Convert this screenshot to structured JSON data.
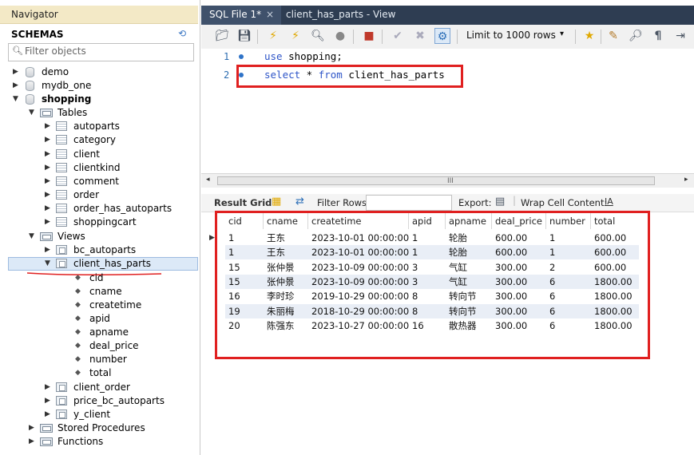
{
  "navigator": {
    "title": "Navigator",
    "schemas_label": "SCHEMAS",
    "filter_placeholder": "Filter objects",
    "schemas": [
      "demo",
      "mydb_one"
    ],
    "active_schema": "shopping",
    "tables_label": "Tables",
    "tables": [
      "autoparts",
      "category",
      "client",
      "clientkind",
      "comment",
      "order",
      "order_has_autoparts",
      "shoppingcart"
    ],
    "views_label": "Views",
    "views_before": [
      "bc_autoparts"
    ],
    "selected_view": "client_has_parts",
    "columns": [
      "cid",
      "cname",
      "createtime",
      "apid",
      "apname",
      "deal_price",
      "number",
      "total"
    ],
    "views_after": [
      "client_order",
      "price_bc_autoparts",
      "y_client"
    ],
    "stored_procedures_label": "Stored Procedures",
    "functions_label": "Functions"
  },
  "tabs": {
    "active": "SQL File 1*",
    "close": "×",
    "other": "client_has_parts - View"
  },
  "toolbar": {
    "limit_label": "Limit to 1000 rows",
    "limit_arrow": "▾"
  },
  "editor": {
    "line_numbers": [
      "1",
      "2"
    ],
    "line1": {
      "kw": "use",
      "rest": " shopping;"
    },
    "line2": {
      "kw1": "select",
      "mid": " * ",
      "kw2": "from",
      "rest": " client_has_parts"
    }
  },
  "scroll": {
    "left": "◂",
    "grip": "III",
    "right": "▸"
  },
  "result_toolbar": {
    "result_grid_label": "Result Grid",
    "filter_rows_label": "Filter Rows:",
    "export_label": "Export:",
    "wrap_label": "Wrap Cell Content:",
    "wrap_icon": "IA"
  },
  "grid": {
    "columns": [
      "cid",
      "cname",
      "createtime",
      "apid",
      "apname",
      "deal_price",
      "number",
      "total"
    ],
    "rows": [
      [
        "1",
        "王东",
        "2023-10-01 00:00:00",
        "1",
        "轮胎",
        "600.00",
        "1",
        "600.00"
      ],
      [
        "1",
        "王东",
        "2023-10-01 00:00:00",
        "1",
        "轮胎",
        "600.00",
        "1",
        "600.00"
      ],
      [
        "15",
        "张仲景",
        "2023-10-09 00:00:00",
        "3",
        "气缸",
        "300.00",
        "2",
        "600.00"
      ],
      [
        "15",
        "张仲景",
        "2023-10-09 00:00:00",
        "3",
        "气缸",
        "300.00",
        "6",
        "1800.00"
      ],
      [
        "16",
        "李时珍",
        "2019-10-29 00:00:00",
        "8",
        "转向节",
        "300.00",
        "6",
        "1800.00"
      ],
      [
        "19",
        "朱丽梅",
        "2018-10-29 00:00:00",
        "8",
        "转向节",
        "300.00",
        "6",
        "1800.00"
      ],
      [
        "20",
        "陈强东",
        "2023-10-27 00:00:00",
        "16",
        "散热器",
        "300.00",
        "6",
        "1800.00"
      ]
    ],
    "stripe_color": "#e9eef6",
    "highlight_color": "#e02020"
  }
}
